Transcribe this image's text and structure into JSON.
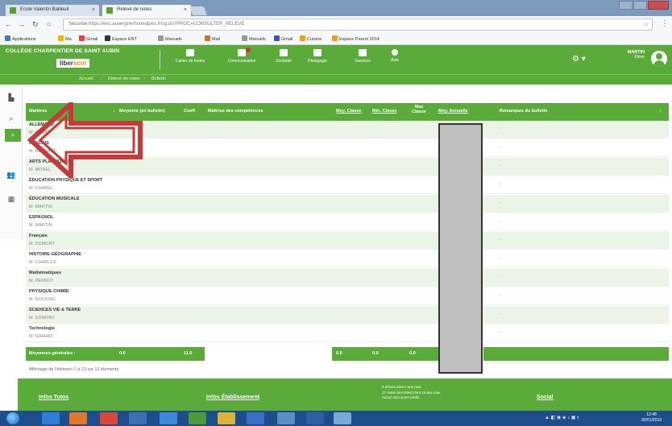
{
  "browser": {
    "tabs": [
      {
        "label": "Ecole Valentin Bailleuil"
      },
      {
        "label": "Relevé de notes"
      }
    ],
    "address": {
      "secure": "Sécurisé",
      "url": "https://enc.auvergnerhonealpes.fr/sg.do?PROC=CONSULTER_RELEVE"
    },
    "bookmarks": [
      "Applications",
      "Ma",
      "Gmail",
      "Espace ENT",
      "Manuels",
      "Mail",
      "Manuels",
      "Gmail",
      "Cuisine",
      "Espace Parent 2014"
    ]
  },
  "header": {
    "school": "COLLÈGE CHARPENTIER DE SAINT AUBIN",
    "logo_main": "liber",
    "logo_accent": "scol",
    "menu": [
      {
        "label": "Cahier de textes",
        "icon": "calendar-icon"
      },
      {
        "label": "Communication",
        "icon": "mail-icon"
      },
      {
        "label": "Scolarité",
        "icon": "grades-icon"
      },
      {
        "label": "Pédagogie",
        "icon": "pedagogy-icon"
      },
      {
        "label": "Services",
        "icon": "services-icon"
      },
      {
        "label": "Aide",
        "icon": "help-icon"
      }
    ],
    "user": {
      "name": "MARTIN",
      "role": "Élève"
    }
  },
  "breadcrumb": [
    "Accueil",
    "Relevé de notes",
    "Bulletin"
  ],
  "table": {
    "columns": [
      "Matières",
      "Moyenne (en bulletin)",
      "Coeff",
      "Maîtrise des compétences",
      "Moy. Classe",
      "Min. Classe",
      "Max Classe",
      "Moy. Annuelle",
      "Remarques du bulletin"
    ],
    "rows": [
      {
        "subject": "ALLEMAND",
        "teacher": "M. PETIT",
        "remark": "-"
      },
      {
        "subject": "ANGLAIS",
        "teacher": "M. BERNARD",
        "remark": "-"
      },
      {
        "subject": "ARTS PLASTIQUES",
        "teacher": "M. MOREL",
        "remark": "-"
      },
      {
        "subject": "ÉDUCATION PHYSIQUE ET SPORT",
        "teacher": "M. CHAREL",
        "remark": "-"
      },
      {
        "subject": "ÉDUCATION MUSICALE",
        "teacher": "M. MARTIN",
        "remark": "-"
      },
      {
        "subject": "ESPAGNOL",
        "teacher": "M. MARTIN",
        "remark": "-"
      },
      {
        "subject": "Français",
        "teacher": "M. DUMONT",
        "remark": "-"
      },
      {
        "subject": "HISTOIRE-GÉOGRAPHIE",
        "teacher": "M. CHARLES",
        "remark": "-"
      },
      {
        "subject": "Mathématiques",
        "teacher": "M. PERROT",
        "remark": "-"
      },
      {
        "subject": "PHYSIQUE-CHIMIE",
        "teacher": "M. ROUSSEL",
        "remark": "-"
      },
      {
        "subject": "SCIENCES VIE & TERRE",
        "teacher": "M. DUMONT",
        "remark": "-"
      },
      {
        "subject": "Technologie",
        "teacher": "M. GIRARD",
        "remark": "-"
      }
    ],
    "footer": {
      "label": "Moyennes générales :",
      "values": [
        "0.0",
        "11.0",
        "0.0",
        "0.0",
        "0.0"
      ]
    }
  },
  "pagination": "Affichage de l'élément 1 à 13 sur 13 éléments",
  "footer": {
    "links": [
      "Infos Tutos",
      "Infos Établissement",
      "Social"
    ],
    "stats": [
      "2 élèves dont 2 ans max",
      "27 notes (inscrites) dont 15 ans max",
      "Aucun document rendu"
    ]
  },
  "taskbar": {
    "time": "12:48",
    "date": "30/01/2019"
  },
  "colors": {
    "accent": "#5aab3a",
    "arrow": "#c43b3b",
    "redaction": "#c0c0c0"
  }
}
